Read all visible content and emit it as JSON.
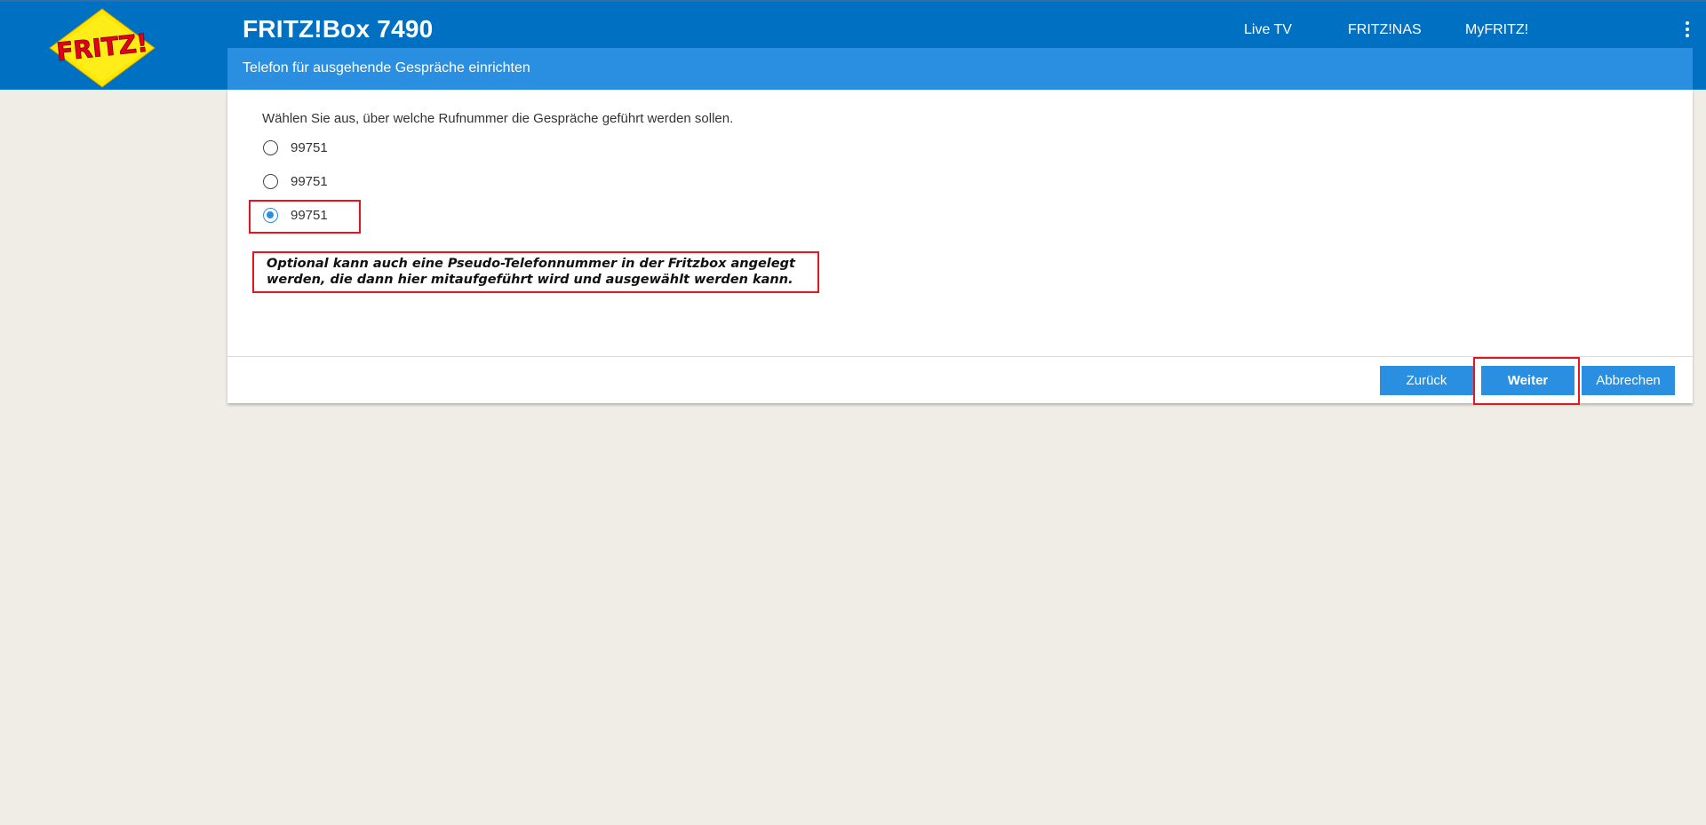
{
  "header": {
    "logo_text": "FRITZ!",
    "product": "FRITZ!Box 7490",
    "nav": [
      "Live TV",
      "FRITZ!NAS",
      "MyFRITZ!"
    ],
    "menu_icon": "kebab-menu-icon"
  },
  "subheader": {
    "title": "Telefon für ausgehende Gespräche einrichten"
  },
  "content": {
    "instruction": "Wählen Sie aus, über welche Rufnummer die Gespräche geführt werden sollen.",
    "options": [
      {
        "label": "99751",
        "selected": false
      },
      {
        "label": "99751",
        "selected": false
      },
      {
        "label": "99751",
        "selected": true
      }
    ],
    "note_line1": "Optional kann auch eine Pseudo-Telefonnummer in der Fritzbox angelegt",
    "note_line2": "werden, die dann hier mitaufgeführt wird und ausgewählt werden kann."
  },
  "buttons": {
    "back": "Zurück",
    "next": "Weiter",
    "cancel": "Abbrechen"
  },
  "colors": {
    "header_blue": "#0070c3",
    "accent_blue": "#2a8fe0",
    "annotation_red": "#e8141e",
    "background": "#f0ede6"
  }
}
